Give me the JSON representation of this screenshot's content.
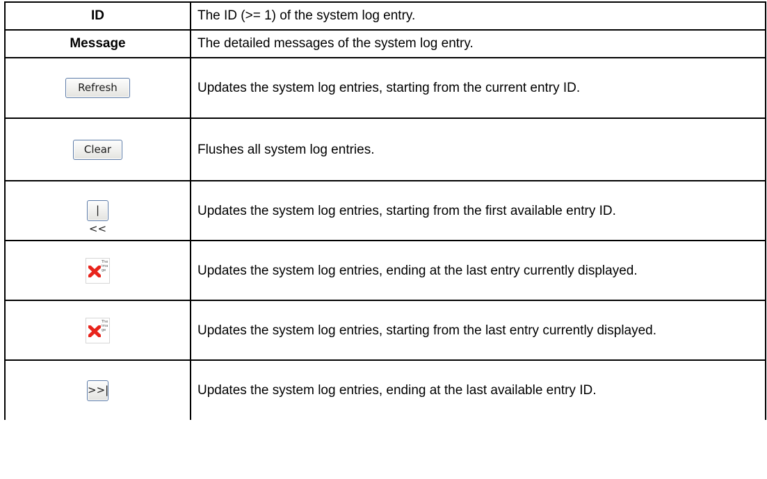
{
  "header": {
    "id_label": "ID",
    "id_desc": "The ID (>= 1) of the system log entry.",
    "message_label": "Message",
    "message_desc": "The detailed messages of the system log entry."
  },
  "rows": [
    {
      "control": "Refresh",
      "icon": "refresh-button",
      "desc": "Updates the system log entries, starting from the current entry ID."
    },
    {
      "control": "Clear",
      "icon": "clear-button",
      "desc": "Flushes all system log entries."
    },
    {
      "control": "|<<",
      "icon": "first-page-button",
      "desc": "Updates the system log entries, starting from the first available entry ID."
    },
    {
      "control_alt_text": "The image",
      "icon": "broken-image-icon",
      "desc": "Updates the system log entries, ending at the last entry currently displayed."
    },
    {
      "control_alt_text": "The image",
      "icon": "broken-image-icon",
      "desc": "Updates the system log entries, starting from the last entry currently displayed."
    },
    {
      "control": ">>|",
      "icon": "last-page-button",
      "desc": "Updates the system log entries, ending at the last available entry ID."
    }
  ],
  "colors": {
    "border": "#000000",
    "button_border": "#5a79a5",
    "broken_image_x": "#e8241c"
  }
}
